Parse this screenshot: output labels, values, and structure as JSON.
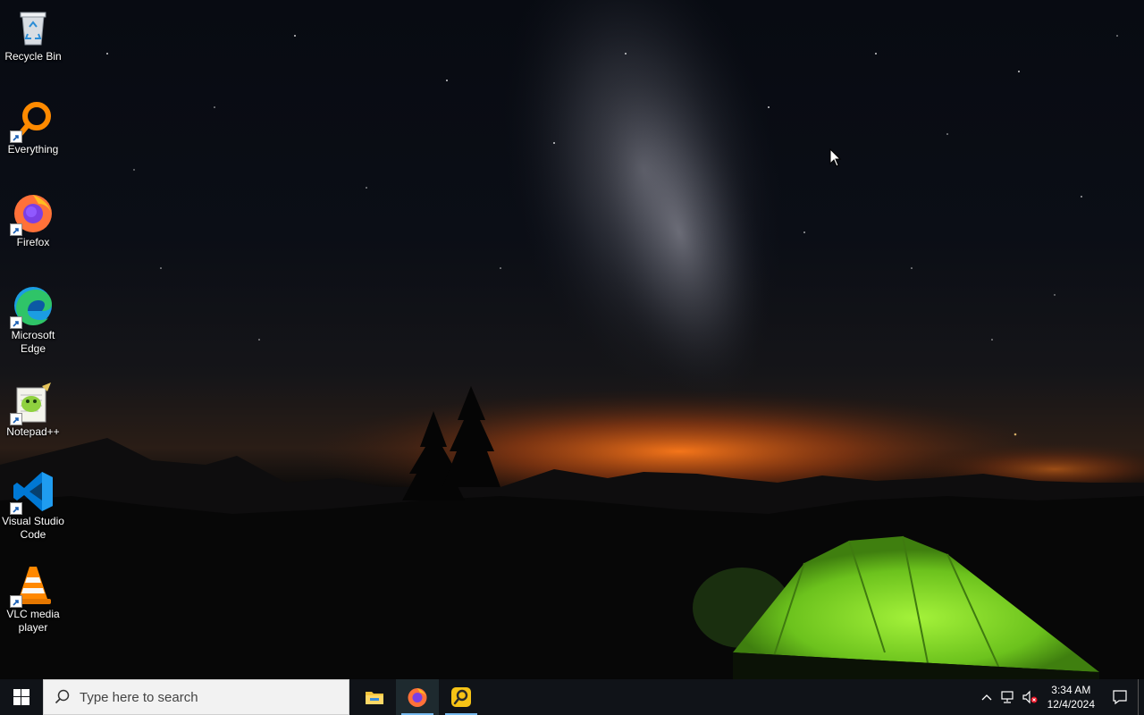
{
  "desktop": {
    "icons": [
      {
        "label": "Recycle Bin",
        "icon": "recycle-bin-icon"
      },
      {
        "label": "Everything",
        "icon": "everything-icon"
      },
      {
        "label": "Firefox",
        "icon": "firefox-icon"
      },
      {
        "label": "Microsoft Edge",
        "icon": "edge-icon"
      },
      {
        "label": "Notepad++",
        "icon": "notepadpp-icon"
      },
      {
        "label": "Visual Studio Code",
        "icon": "vscode-icon"
      },
      {
        "label": "VLC media player",
        "icon": "vlc-icon"
      }
    ]
  },
  "taskbar": {
    "search_placeholder": "Type here to search",
    "apps": [
      {
        "name": "File Explorer",
        "icon": "file-explorer-icon"
      },
      {
        "name": "Firefox",
        "icon": "firefox-icon",
        "active": true
      },
      {
        "name": "Everything",
        "icon": "everything-icon"
      }
    ],
    "clock": {
      "time": "3:34 AM",
      "date": "12/4/2024"
    }
  },
  "colors": {
    "taskbar": "#101318",
    "accent": "#76b9ed",
    "tent": "#7bd32a"
  }
}
